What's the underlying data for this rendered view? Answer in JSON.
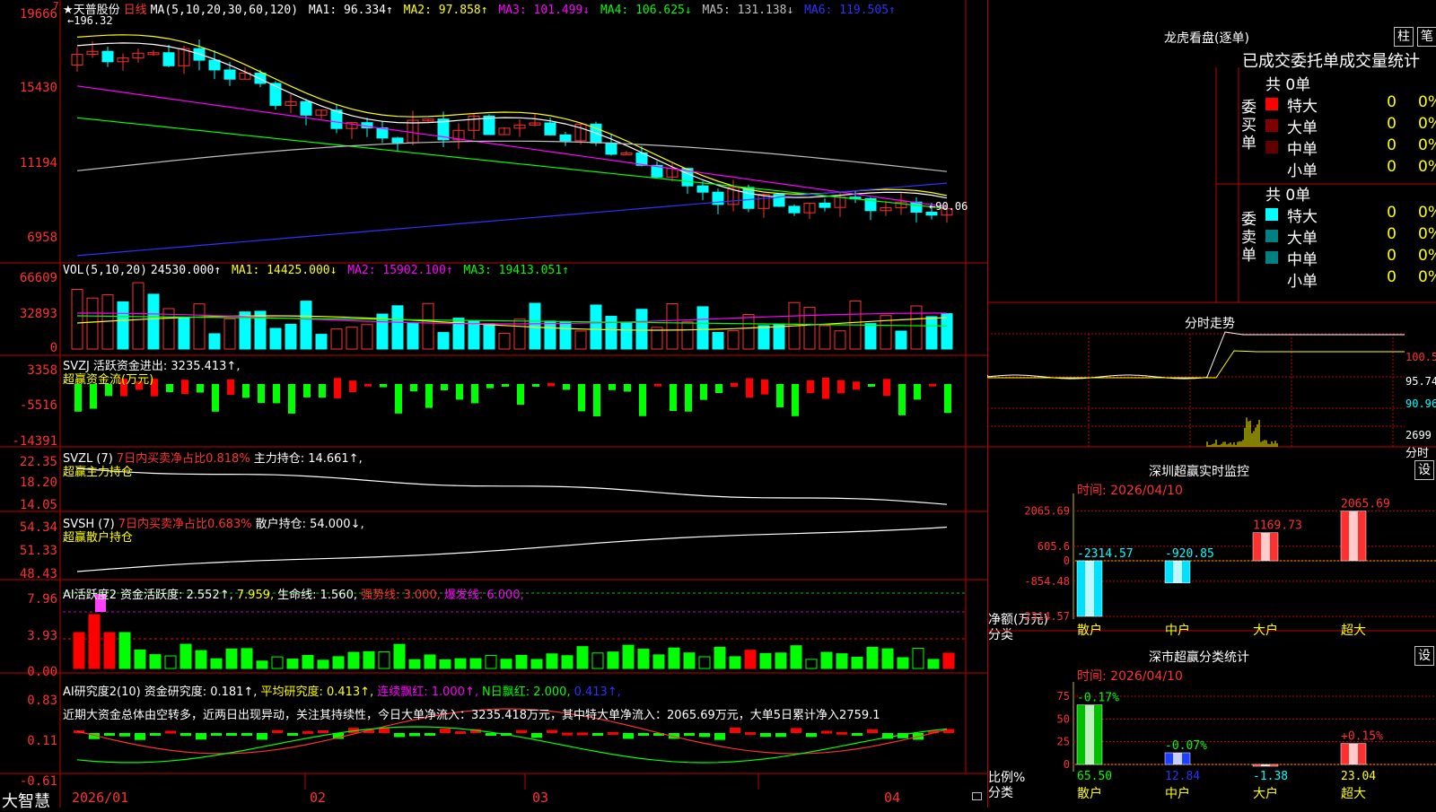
{
  "app": {
    "brand": "大智慧",
    "stock_name": "★天普股份",
    "period": "日线"
  },
  "colors": {
    "up": "#ff3030",
    "down": "#00ffff",
    "ma5": "#ffffff",
    "ma10": "#ffff00",
    "ma20": "#ff00ff",
    "ma30": "#00ff00",
    "ma60": "#c0c0c0",
    "ma120": "#3030ff",
    "grid": "#c00000"
  },
  "main_chart": {
    "ma_label": "MA(5,10,20,30,60,120)",
    "ma1": "MA1: 96.334↑",
    "ma2": "MA2: 97.858↑",
    "ma3": "MA3: 101.499↓",
    "ma4": "MA4: 106.625↓",
    "ma5": "MA5: 131.138↓",
    "ma6": "MA6: 119.505↑",
    "y_ticks": [
      "19666",
      "15430",
      "11194",
      "6958"
    ],
    "high_marker": "←196.32",
    "low_marker": "←90.06",
    "top_mark": "7"
  },
  "vol_panel": {
    "label": "VOL(5,10,20)",
    "value": "24530.000↑",
    "ma1": "MA1: 14425.000↓",
    "ma2": "MA2: 15902.100↑",
    "ma3": "MA3: 19413.051↑",
    "y_ticks": [
      "66609",
      "32893",
      "0"
    ]
  },
  "svzj_panel": {
    "label": "SVZJ",
    "text": "活跃资金进出: 3235.413↑,",
    "subtitle": "超赢资金流(万元)",
    "y_ticks": [
      "3358",
      "-5516",
      "-14391"
    ]
  },
  "svzl_panel": {
    "label": "SVZL (7)",
    "text1": "7日内买卖净占比0.818%",
    "text2": "主力持仓: 14.661↑,",
    "subtitle": "超赢主力持仓",
    "y_ticks": [
      "22.35",
      "18.20",
      "14.05"
    ]
  },
  "svsh_panel": {
    "label": "SVSH (7)",
    "text1": "7日内买卖净占比0.683%",
    "text2": "散户持仓: 54.000↓,",
    "subtitle": "超赢散户持仓",
    "y_ticks": [
      "54.34",
      "51.33",
      "48.43"
    ]
  },
  "ai_active_panel": {
    "label": "AI活跃度2",
    "t1": "资金活跃度: 2.552↑,",
    "t2": "7.959,",
    "t3": "生命线: 1.560,",
    "t4": "强势线: 3.000,",
    "t5": "爆发线: 6.000,",
    "y_ticks": [
      "7.96",
      "3.93",
      "0.00"
    ]
  },
  "ai_research_panel": {
    "label": "AI研究度2(10)",
    "t1": "资金研究度: 0.181↑,",
    "t2": "平均研究度: 0.413↑,",
    "t3": "连续飘红: 1.000↑,",
    "t4": "N日飘红: 2.000,",
    "t5": "0.413↑,",
    "comment": "近期大资金总体由空转多，近两日出现异动，关注其持续性，今日大单净流入：3235.418万元，其中特大单净流入：2065.69万元，大单5日累计净入2759.1",
    "y_ticks": [
      "0.83",
      "0.11",
      "-0.61"
    ]
  },
  "date_axis": [
    "2026/01",
    "02",
    "03",
    "04"
  ],
  "right_panel": {
    "dragon": {
      "title": "龙虎看盘(逐单)",
      "btn_bar": "柱",
      "btn_pen": "笔",
      "header": "已成交委托单成交量统计",
      "buy_side": {
        "label": "委买单",
        "total": "共 0单",
        "rows": [
          {
            "name": "特大",
            "count": "0",
            "pct": "0%",
            "color": "#ff0000"
          },
          {
            "name": "大单",
            "count": "0",
            "pct": "0%",
            "color": "#800000"
          },
          {
            "name": "中单",
            "count": "0",
            "pct": "0%",
            "color": "#600000"
          },
          {
            "name": "小单",
            "count": "0",
            "pct": "0%",
            "color": "#000000"
          }
        ]
      },
      "sell_side": {
        "label": "委卖单",
        "total": "共 0单",
        "rows": [
          {
            "name": "特大",
            "count": "0",
            "pct": "0%",
            "color": "#00ffff"
          },
          {
            "name": "大单",
            "count": "0",
            "pct": "0%",
            "color": "#008080"
          },
          {
            "name": "中单",
            "count": "0",
            "pct": "0%",
            "color": "#008080"
          },
          {
            "name": "小单",
            "count": "0",
            "pct": "0%",
            "color": "#000000"
          }
        ]
      }
    },
    "intraday": {
      "title": "分时走势",
      "y_ticks": [
        "100.5",
        "95.74",
        "90.96",
        "2699"
      ],
      "unit": "分时"
    },
    "sz_monitor": {
      "title": "深圳超赢实时监控",
      "btn": "设",
      "time": "时间: 2026/04/10",
      "y_ticks": [
        "2065.69",
        "605.6",
        "0",
        "-854.48",
        "-2314.57"
      ],
      "ylabel": "净额(万元)",
      "xlabel": "分类"
    },
    "sz_class": {
      "title": "深市超赢分类统计",
      "btn": "设",
      "time": "时间: 2026/04/10",
      "y_ticks": [
        "75",
        "50",
        "25",
        "0"
      ],
      "ylabel": "比例%",
      "xlabel": "分类"
    }
  },
  "chart_data": [
    {
      "type": "bar",
      "title": "深圳超赢实时监控",
      "ylabel": "净额(万元)",
      "xlabel": "分类",
      "categories": [
        "散户",
        "中户",
        "大户",
        "超大"
      ],
      "values": [
        -2314.57,
        -920.85,
        1169.73,
        2065.69
      ],
      "ylim": [
        -2314.57,
        2065.69
      ]
    },
    {
      "type": "bar",
      "title": "深市超赢分类统计",
      "ylabel": "比例%",
      "xlabel": "分类",
      "categories": [
        "散户",
        "中户",
        "大户",
        "超大"
      ],
      "values": [
        65.5,
        12.84,
        -1.38,
        23.04
      ],
      "labels": [
        "-0.17%",
        "-0.07%",
        "",
        "+0.15%"
      ],
      "ylim": [
        0,
        75
      ]
    }
  ]
}
